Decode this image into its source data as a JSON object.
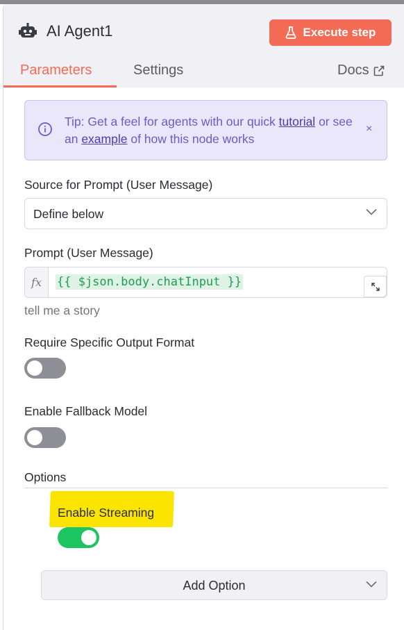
{
  "header": {
    "title": "AI Agent1",
    "execute_label": "Execute step",
    "tabs": [
      {
        "label": "Parameters",
        "active": true
      },
      {
        "label": "Settings",
        "active": false
      },
      {
        "label": "Docs",
        "active": false
      }
    ]
  },
  "tip": {
    "prefix": "Tip: Get a feel for agents with our quick ",
    "link1": "tutorial",
    "middle": " or see an ",
    "link2": "example",
    "suffix": " of how this node works",
    "close": "×"
  },
  "source": {
    "label": "Source for Prompt (User Message)",
    "value": "Define below"
  },
  "prompt": {
    "label": "Prompt (User Message)",
    "fx": "fx",
    "expression": "{{ $json.body.chatInput }}",
    "preview": "tell me a story"
  },
  "output_format": {
    "label": "Require Specific Output Format",
    "enabled": false
  },
  "fallback": {
    "label": "Enable Fallback Model",
    "enabled": false
  },
  "options": {
    "label": "Options",
    "streaming_label": "Enable Streaming",
    "streaming_enabled": true,
    "add_option_label": "Add Option"
  },
  "colors": {
    "accent": "#f36b55",
    "toggle_on": "#1dc462",
    "toggle_off": "#8e8e96",
    "tip_bg": "#ebe7fb",
    "highlight": "#fbe400"
  },
  "icons": {
    "node": "robot-icon",
    "execute": "flask-icon",
    "docs": "external-link-icon",
    "tip": "info-icon",
    "expand": "expand-icon",
    "dropdown": "chevron-down-icon"
  }
}
